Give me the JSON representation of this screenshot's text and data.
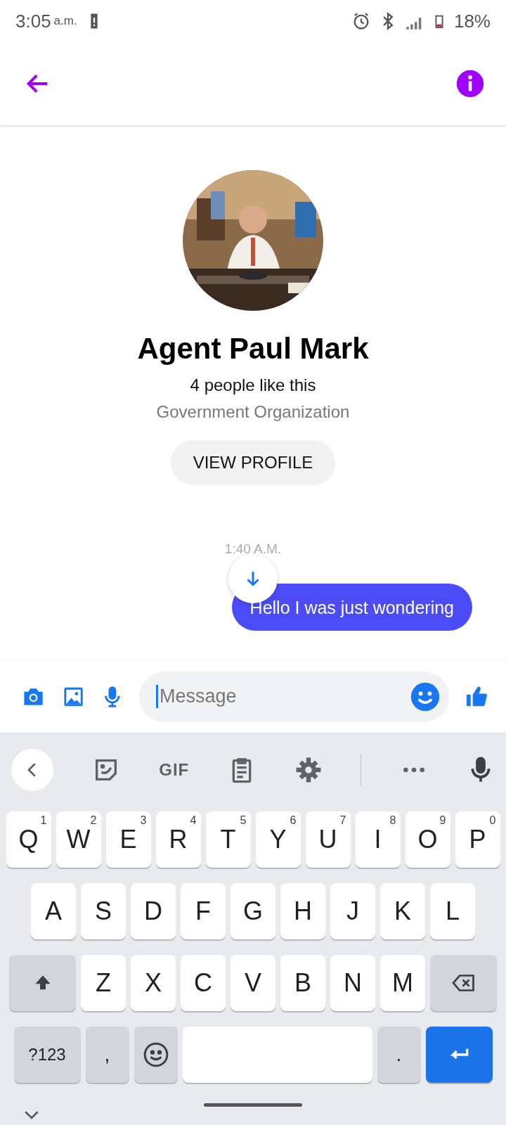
{
  "status_bar": {
    "time": "3:05",
    "ampm": "a.m.",
    "battery": "18%"
  },
  "profile": {
    "name": "Agent Paul Mark",
    "likes": "4 people like this",
    "category": "Government Organization",
    "button": "VIEW PROFILE"
  },
  "messages": [
    {
      "kind": "timestamp",
      "text": "1:40 A.M."
    },
    {
      "kind": "outgoing",
      "text": "Hello I was just wondering"
    }
  ],
  "composer": {
    "placeholder": "Message"
  },
  "keyboard": {
    "toolbar": [
      "GIF"
    ],
    "key_rows": [
      {
        "keys": [
          {
            "label": "Q",
            "hint": "1"
          },
          {
            "label": "W",
            "hint": "2"
          },
          {
            "label": "E",
            "hint": "3"
          },
          {
            "label": "R",
            "hint": "4"
          },
          {
            "label": "T",
            "hint": "5"
          },
          {
            "label": "Y",
            "hint": "6"
          },
          {
            "label": "U",
            "hint": "7"
          },
          {
            "label": "I",
            "hint": "8"
          },
          {
            "label": "O",
            "hint": "9"
          },
          {
            "label": "P",
            "hint": "0"
          }
        ]
      },
      {
        "keys": [
          {
            "label": "A"
          },
          {
            "label": "S"
          },
          {
            "label": "D"
          },
          {
            "label": "F"
          },
          {
            "label": "G"
          },
          {
            "label": "H"
          },
          {
            "label": "J"
          },
          {
            "label": "K"
          },
          {
            "label": "L"
          }
        ]
      },
      {
        "keys": [
          {
            "kind": "shift"
          },
          {
            "label": "Z"
          },
          {
            "label": "X"
          },
          {
            "label": "C"
          },
          {
            "label": "V"
          },
          {
            "label": "B"
          },
          {
            "label": "N"
          },
          {
            "label": "M"
          },
          {
            "kind": "backspace"
          }
        ]
      },
      {
        "keys": [
          {
            "kind": "mode",
            "label": "?123"
          },
          {
            "kind": "punct",
            "label": ","
          },
          {
            "kind": "emoji"
          },
          {
            "kind": "space"
          },
          {
            "kind": "punct",
            "label": "."
          },
          {
            "kind": "enter"
          }
        ]
      }
    ]
  }
}
